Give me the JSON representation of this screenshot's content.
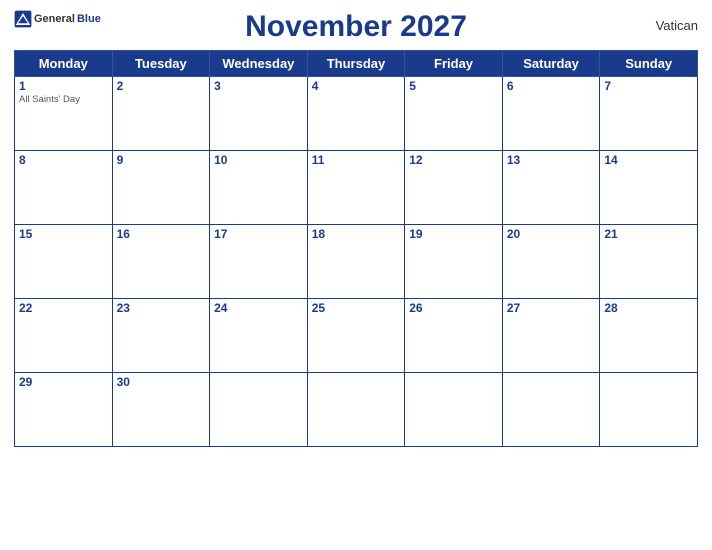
{
  "header": {
    "title": "November 2027",
    "region": "Vatican",
    "logo_general": "General",
    "logo_blue": "Blue"
  },
  "weekdays": [
    "Monday",
    "Tuesday",
    "Wednesday",
    "Thursday",
    "Friday",
    "Saturday",
    "Sunday"
  ],
  "weeks": [
    [
      {
        "day": "1",
        "holiday": "All Saints' Day"
      },
      {
        "day": "2",
        "holiday": ""
      },
      {
        "day": "3",
        "holiday": ""
      },
      {
        "day": "4",
        "holiday": ""
      },
      {
        "day": "5",
        "holiday": ""
      },
      {
        "day": "6",
        "holiday": ""
      },
      {
        "day": "7",
        "holiday": ""
      }
    ],
    [
      {
        "day": "8",
        "holiday": ""
      },
      {
        "day": "9",
        "holiday": ""
      },
      {
        "day": "10",
        "holiday": ""
      },
      {
        "day": "11",
        "holiday": ""
      },
      {
        "day": "12",
        "holiday": ""
      },
      {
        "day": "13",
        "holiday": ""
      },
      {
        "day": "14",
        "holiday": ""
      }
    ],
    [
      {
        "day": "15",
        "holiday": ""
      },
      {
        "day": "16",
        "holiday": ""
      },
      {
        "day": "17",
        "holiday": ""
      },
      {
        "day": "18",
        "holiday": ""
      },
      {
        "day": "19",
        "holiday": ""
      },
      {
        "day": "20",
        "holiday": ""
      },
      {
        "day": "21",
        "holiday": ""
      }
    ],
    [
      {
        "day": "22",
        "holiday": ""
      },
      {
        "day": "23",
        "holiday": ""
      },
      {
        "day": "24",
        "holiday": ""
      },
      {
        "day": "25",
        "holiday": ""
      },
      {
        "day": "26",
        "holiday": ""
      },
      {
        "day": "27",
        "holiday": ""
      },
      {
        "day": "28",
        "holiday": ""
      }
    ],
    [
      {
        "day": "29",
        "holiday": ""
      },
      {
        "day": "30",
        "holiday": ""
      },
      {
        "day": "",
        "holiday": ""
      },
      {
        "day": "",
        "holiday": ""
      },
      {
        "day": "",
        "holiday": ""
      },
      {
        "day": "",
        "holiday": ""
      },
      {
        "day": "",
        "holiday": ""
      }
    ]
  ]
}
